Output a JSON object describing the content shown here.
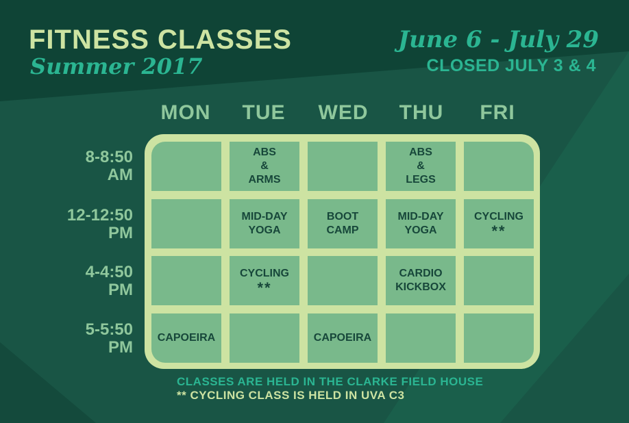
{
  "header": {
    "title": "FITNESS CLASSES",
    "subtitle": "Summer 2017",
    "dates": "June 6 - July 29",
    "closed": "CLOSED JULY 3 & 4"
  },
  "days": [
    "MON",
    "TUE",
    "WED",
    "THU",
    "FRI"
  ],
  "times": [
    {
      "line1": "8-8:50",
      "line2": "AM"
    },
    {
      "line1": "12-12:50",
      "line2": "PM"
    },
    {
      "line1": "4-4:50",
      "line2": "PM"
    },
    {
      "line1": "5-5:50",
      "line2": "PM"
    }
  ],
  "schedule": [
    [
      {
        "lines": []
      },
      {
        "lines": [
          "ABS",
          "&",
          "ARMS"
        ]
      },
      {
        "lines": []
      },
      {
        "lines": [
          "ABS",
          "&",
          "LEGS"
        ]
      },
      {
        "lines": []
      }
    ],
    [
      {
        "lines": []
      },
      {
        "lines": [
          "MID-DAY",
          "YOGA"
        ]
      },
      {
        "lines": [
          "BOOT",
          "CAMP"
        ]
      },
      {
        "lines": [
          "MID-DAY",
          "YOGA"
        ]
      },
      {
        "lines": [
          "CYCLING"
        ],
        "stars": "**"
      }
    ],
    [
      {
        "lines": []
      },
      {
        "lines": [
          "CYCLING"
        ],
        "stars": "**"
      },
      {
        "lines": []
      },
      {
        "lines": [
          "CARDIO",
          "KICKBOX"
        ]
      },
      {
        "lines": []
      }
    ],
    [
      {
        "lines": [
          "CAPOEIRA"
        ]
      },
      {
        "lines": []
      },
      {
        "lines": [
          "CAPOEIRA"
        ]
      },
      {
        "lines": []
      },
      {
        "lines": []
      }
    ]
  ],
  "footer": {
    "location_note": "CLASSES ARE HELD IN THE CLARKE FIELD HOUSE",
    "cycling_note": "** CYCLING CLASS IS HELD IN UVA C3"
  },
  "colors": {
    "background": "#195545",
    "board": "#cde3a2",
    "cell": "#79b98b",
    "accent_teal": "#2bb592",
    "muted_green": "#8fc79c"
  }
}
